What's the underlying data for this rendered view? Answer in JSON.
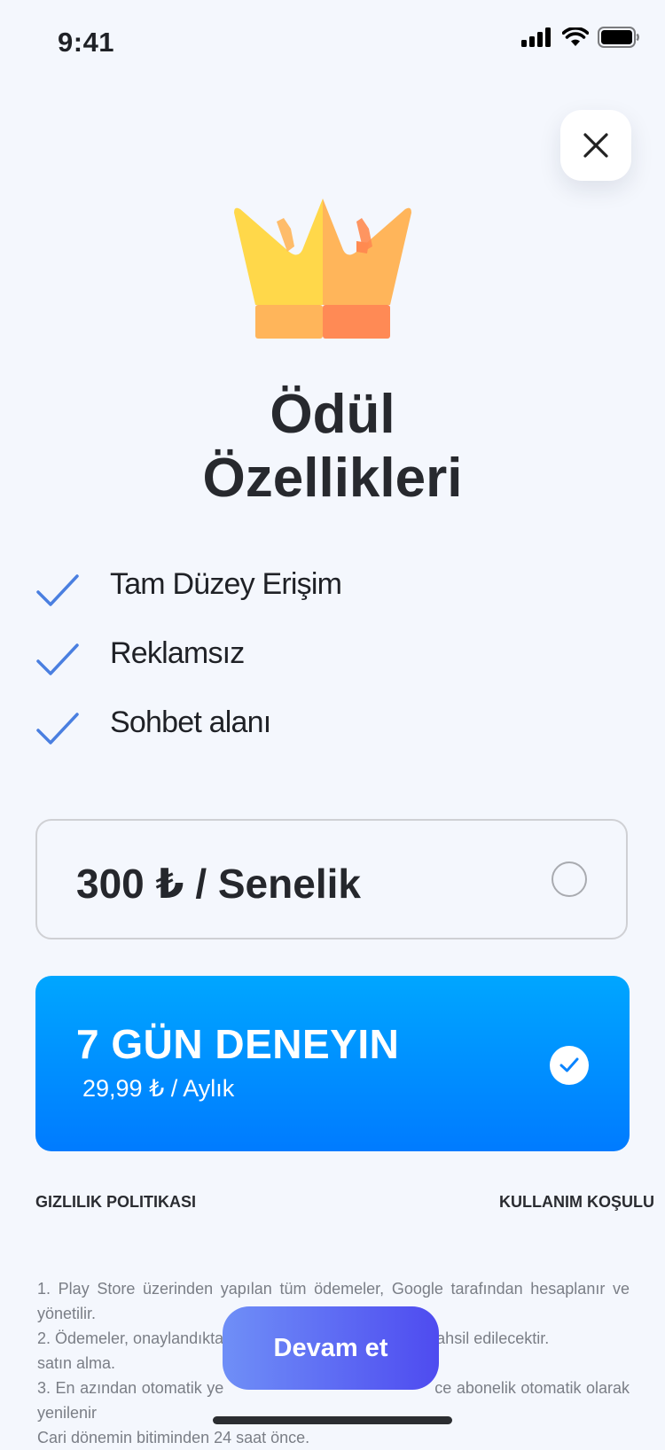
{
  "status_bar": {
    "time": "9:41"
  },
  "header": {
    "title_line1": "Ödül",
    "title_line2": "Özellikleri"
  },
  "features": [
    {
      "label": "Tam Düzey Erişim"
    },
    {
      "label": "Reklamsız"
    },
    {
      "label": "Sohbet alanı"
    }
  ],
  "plans": {
    "yearly": {
      "label": "300 ₺ / Senelik",
      "selected": false
    },
    "trial": {
      "title": "7 GÜN DENEYIN",
      "price": "29,99 ₺ / Aylık",
      "selected": true
    }
  },
  "links": {
    "privacy": "GIZLILIK POLITIKASI",
    "terms": "KULLANIM KOŞULU"
  },
  "terms_text": [
    "1. Play Store üzerinden yapılan tüm ödemeler, Google tarafından hesaplanır ve yönetilir.",
    "2. Ödemeler, onaylandıkta",
    "dan tahsil edilecektir.",
    "satın alma.",
    "3. En azından otomatik ye",
    "ce abonelik otomatik olarak yenilenir",
    "Cari dönemin bitiminden 24 saat önce."
  ],
  "cta": {
    "label": "Devam et"
  },
  "colors": {
    "accent": "#007bff",
    "check": "#4a7fe0",
    "cta_start": "#6f8ff7",
    "cta_end": "#4e4bf0"
  }
}
